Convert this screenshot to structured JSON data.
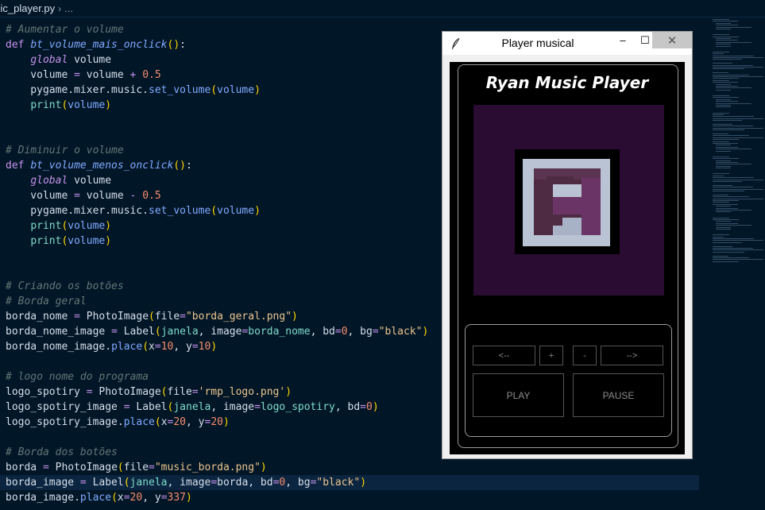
{
  "breadcrumb": {
    "file": "sic_player.py",
    "more": "..."
  },
  "code_lines": [
    [
      {
        "c": "cm",
        "t": "# Aumentar o volume"
      }
    ],
    [
      {
        "c": "kw",
        "t": "def "
      },
      {
        "c": "fn",
        "t": "bt_volume_mais_onclick"
      },
      {
        "c": "pun",
        "t": "()"
      },
      {
        "c": "",
        "t": ":"
      }
    ],
    [
      {
        "c": "",
        "t": "    "
      },
      {
        "c": "gl",
        "t": "global"
      },
      {
        "c": "",
        "t": " volume"
      }
    ],
    [
      {
        "c": "",
        "t": "    volume "
      },
      {
        "c": "op",
        "t": "="
      },
      {
        "c": "",
        "t": " volume "
      },
      {
        "c": "op",
        "t": "+"
      },
      {
        "c": "nm",
        "t": " 0.5"
      }
    ],
    [
      {
        "c": "",
        "t": "    pygame.mixer.music."
      },
      {
        "c": "call",
        "t": "set_volume"
      },
      {
        "c": "pun",
        "t": "("
      },
      {
        "c": "call",
        "t": "volume"
      },
      {
        "c": "pun",
        "t": ")"
      }
    ],
    [
      {
        "c": "",
        "t": "    "
      },
      {
        "c": "pr",
        "t": "print"
      },
      {
        "c": "pun",
        "t": "("
      },
      {
        "c": "call",
        "t": "volume"
      },
      {
        "c": "pun",
        "t": ")"
      }
    ],
    [
      {
        "c": "",
        "t": ""
      }
    ],
    [
      {
        "c": "",
        "t": ""
      }
    ],
    [
      {
        "c": "cm",
        "t": "# Diminuir o volume"
      }
    ],
    [
      {
        "c": "kw",
        "t": "def "
      },
      {
        "c": "fn",
        "t": "bt_volume_menos_onclick"
      },
      {
        "c": "pun",
        "t": "()"
      },
      {
        "c": "",
        "t": ":"
      }
    ],
    [
      {
        "c": "",
        "t": "    "
      },
      {
        "c": "gl",
        "t": "global"
      },
      {
        "c": "",
        "t": " volume"
      }
    ],
    [
      {
        "c": "",
        "t": "    volume "
      },
      {
        "c": "op",
        "t": "="
      },
      {
        "c": "",
        "t": " volume "
      },
      {
        "c": "op",
        "t": "-"
      },
      {
        "c": "nm",
        "t": " 0.5"
      }
    ],
    [
      {
        "c": "",
        "t": "    pygame.mixer.music."
      },
      {
        "c": "call",
        "t": "set_volume"
      },
      {
        "c": "pun",
        "t": "("
      },
      {
        "c": "call",
        "t": "volume"
      },
      {
        "c": "pun",
        "t": ")"
      }
    ],
    [
      {
        "c": "",
        "t": "    "
      },
      {
        "c": "pr",
        "t": "print"
      },
      {
        "c": "pun",
        "t": "("
      },
      {
        "c": "call",
        "t": "volume"
      },
      {
        "c": "pun",
        "t": ")"
      }
    ],
    [
      {
        "c": "",
        "t": "    "
      },
      {
        "c": "pr",
        "t": "print"
      },
      {
        "c": "pun",
        "t": "("
      },
      {
        "c": "call",
        "t": "volume"
      },
      {
        "c": "pun",
        "t": ")"
      }
    ],
    [
      {
        "c": "",
        "t": ""
      }
    ],
    [
      {
        "c": "",
        "t": ""
      }
    ],
    [
      {
        "c": "cm",
        "t": "# Criando os botões"
      }
    ],
    [
      {
        "c": "cm",
        "t": "# Borda geral"
      }
    ],
    [
      {
        "c": "",
        "t": "borda_nome "
      },
      {
        "c": "op",
        "t": "="
      },
      {
        "c": "",
        "t": " PhotoImage"
      },
      {
        "c": "pun",
        "t": "("
      },
      {
        "c": "kwarg",
        "t": "file"
      },
      {
        "c": "op",
        "t": "="
      },
      {
        "c": "st",
        "t": "\"borda_geral.png\""
      },
      {
        "c": "pun",
        "t": ")"
      }
    ],
    [
      {
        "c": "",
        "t": "borda_nome_image "
      },
      {
        "c": "op",
        "t": "="
      },
      {
        "c": "",
        "t": " Label"
      },
      {
        "c": "pun",
        "t": "("
      },
      {
        "c": "var2",
        "t": "janela"
      },
      {
        "c": "",
        "t": ", image"
      },
      {
        "c": "op",
        "t": "="
      },
      {
        "c": "var2",
        "t": "borda_nome"
      },
      {
        "c": "",
        "t": ", bd"
      },
      {
        "c": "op",
        "t": "="
      },
      {
        "c": "nm",
        "t": "0"
      },
      {
        "c": "",
        "t": ", bg"
      },
      {
        "c": "op",
        "t": "="
      },
      {
        "c": "st",
        "t": "\"black\""
      },
      {
        "c": "pun",
        "t": ")"
      }
    ],
    [
      {
        "c": "",
        "t": "borda_nome_image."
      },
      {
        "c": "call",
        "t": "place"
      },
      {
        "c": "pun",
        "t": "("
      },
      {
        "c": "",
        "t": "x"
      },
      {
        "c": "op",
        "t": "="
      },
      {
        "c": "nm",
        "t": "10"
      },
      {
        "c": "",
        "t": ", y"
      },
      {
        "c": "op",
        "t": "="
      },
      {
        "c": "nm",
        "t": "10"
      },
      {
        "c": "pun",
        "t": ")"
      }
    ],
    [
      {
        "c": "",
        "t": ""
      }
    ],
    [
      {
        "c": "cm",
        "t": "# logo nome do programa"
      }
    ],
    [
      {
        "c": "",
        "t": "logo_spotiry "
      },
      {
        "c": "op",
        "t": "="
      },
      {
        "c": "",
        "t": " PhotoImage"
      },
      {
        "c": "pun",
        "t": "("
      },
      {
        "c": "kwarg",
        "t": "file"
      },
      {
        "c": "op",
        "t": "="
      },
      {
        "c": "st",
        "t": "'rmp_logo.png'"
      },
      {
        "c": "pun",
        "t": ")"
      }
    ],
    [
      {
        "c": "",
        "t": "logo_spotiry_image "
      },
      {
        "c": "op",
        "t": "="
      },
      {
        "c": "",
        "t": " Label"
      },
      {
        "c": "pun",
        "t": "("
      },
      {
        "c": "var2",
        "t": "janela"
      },
      {
        "c": "",
        "t": ", image"
      },
      {
        "c": "op",
        "t": "="
      },
      {
        "c": "var2",
        "t": "logo_spotiry"
      },
      {
        "c": "",
        "t": ", bd"
      },
      {
        "c": "op",
        "t": "="
      },
      {
        "c": "nm",
        "t": "0"
      },
      {
        "c": "pun",
        "t": ")"
      }
    ],
    [
      {
        "c": "",
        "t": "logo_spotiry_image."
      },
      {
        "c": "call",
        "t": "place"
      },
      {
        "c": "pun",
        "t": "("
      },
      {
        "c": "",
        "t": "x"
      },
      {
        "c": "op",
        "t": "="
      },
      {
        "c": "nm",
        "t": "20"
      },
      {
        "c": "",
        "t": ", y"
      },
      {
        "c": "op",
        "t": "="
      },
      {
        "c": "nm",
        "t": "20"
      },
      {
        "c": "pun",
        "t": ")"
      }
    ],
    [
      {
        "c": "",
        "t": ""
      }
    ],
    [
      {
        "c": "cm",
        "t": "# Borda dos botões"
      }
    ],
    [
      {
        "c": "",
        "t": "borda "
      },
      {
        "c": "op",
        "t": "="
      },
      {
        "c": "",
        "t": " PhotoImage"
      },
      {
        "c": "pun",
        "t": "("
      },
      {
        "c": "kwarg",
        "t": "file"
      },
      {
        "c": "op",
        "t": "="
      },
      {
        "c": "st",
        "t": "\"music_borda.png\""
      },
      {
        "c": "pun",
        "t": ")"
      }
    ],
    [
      {
        "c": "",
        "t": "borda_image "
      },
      {
        "c": "op",
        "t": "="
      },
      {
        "c": "",
        "t": " Label"
      },
      {
        "c": "pun",
        "t": "("
      },
      {
        "c": "var2",
        "t": "janela"
      },
      {
        "c": "",
        "t": ", image"
      },
      {
        "c": "op",
        "t": "="
      },
      {
        "c": "",
        "t": "borda, bd"
      },
      {
        "c": "op",
        "t": "="
      },
      {
        "c": "nm",
        "t": "0"
      },
      {
        "c": "",
        "t": ", bg"
      },
      {
        "c": "op",
        "t": "="
      },
      {
        "c": "st",
        "t": "\"black\""
      },
      {
        "c": "pun",
        "t": ")"
      }
    ],
    [
      {
        "c": "",
        "t": "borda_image."
      },
      {
        "c": "call",
        "t": "place"
      },
      {
        "c": "pun",
        "t": "("
      },
      {
        "c": "",
        "t": "x"
      },
      {
        "c": "op",
        "t": "="
      },
      {
        "c": "nm",
        "t": "20"
      },
      {
        "c": "",
        "t": ", y"
      },
      {
        "c": "op",
        "t": "="
      },
      {
        "c": "nm",
        "t": "337"
      },
      {
        "c": "pun",
        "t": ")"
      }
    ]
  ],
  "active_line_index": 30,
  "player_window": {
    "title": "Player musical",
    "app_title": "Ryan Music Player",
    "buttons": {
      "prev": "<--",
      "plus": "+",
      "minus": "-",
      "next": "-->",
      "play": "PLAY",
      "pause": "PAUSE"
    },
    "window_controls": {
      "minimize": "–",
      "maximize": "☐",
      "close": "✕"
    }
  },
  "colors": {
    "editor_bg": "#011627",
    "album_bg": "#2a0c33",
    "comment": "#637777",
    "keyword": "#c792ea",
    "string": "#ecc48d",
    "number": "#f78c6c"
  },
  "icons": {
    "tk_feather": "feather-icon",
    "breadcrumb_chevron": "chevron-right-icon"
  }
}
